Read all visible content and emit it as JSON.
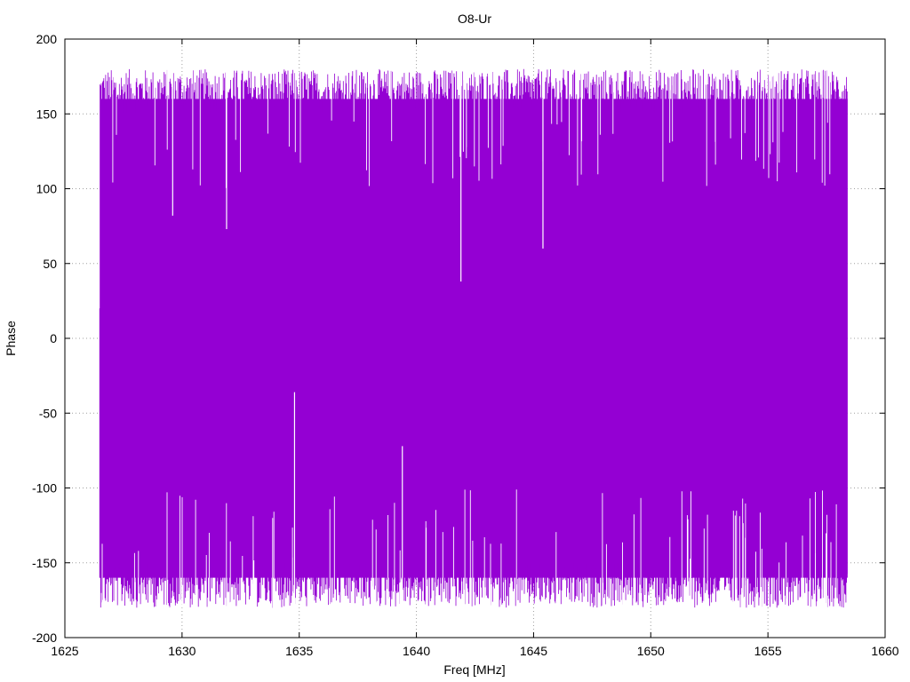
{
  "chart_data": {
    "type": "line",
    "title": "O8-Ur",
    "xlabel": "Freq [MHz]",
    "ylabel": "Phase",
    "xlim": [
      1625,
      1660
    ],
    "ylim": [
      -200,
      200
    ],
    "x_ticks": [
      1625,
      1630,
      1635,
      1640,
      1645,
      1650,
      1655,
      1660
    ],
    "y_ticks": [
      200,
      150,
      100,
      50,
      0,
      -50,
      -100,
      -150,
      -200
    ],
    "grid": true,
    "legend": "none",
    "line_color": "#9400d3",
    "series": [
      {
        "x_start": 1626.5,
        "x_end": 1658.4,
        "y_range": [
          -180,
          180
        ],
        "description_pattern": "dense phase wrapping between -180 and 180"
      }
    ],
    "notable_spikes": [
      {
        "x": 1641.9,
        "y_max": 38
      },
      {
        "x": 1634.8,
        "y_min": -36
      },
      {
        "x": 1645.4,
        "y_max": 60
      },
      {
        "x": 1639.4,
        "y_min": -72
      },
      {
        "x": 1629.6,
        "y_max": 82
      },
      {
        "x": 1631.9,
        "y_max": 73
      }
    ]
  }
}
